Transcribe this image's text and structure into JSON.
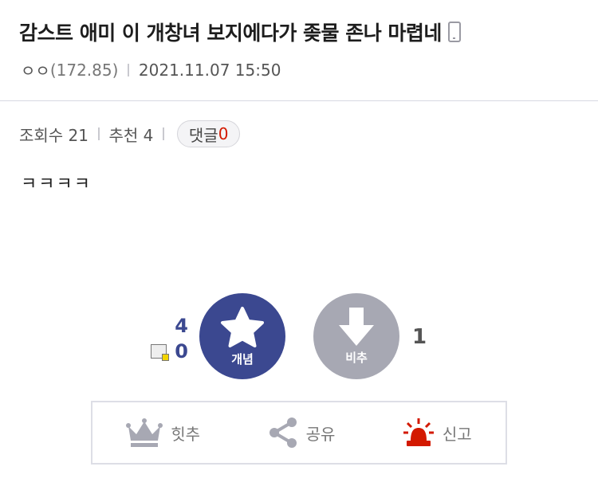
{
  "post": {
    "title": "감스트 애미 이 개창녀 보지에다가 좆물 존나 마렵네",
    "author": "ㅇㅇ",
    "author_ip": "(172.85)",
    "datetime": "2021.11.07 15:50"
  },
  "stats": {
    "views_label": "조회수 21",
    "recommend_label": "추천 4",
    "comment_label": "댓글",
    "comment_count": "0"
  },
  "content": {
    "body": "ㅋㅋㅋㅋ"
  },
  "vote": {
    "up_count": "4",
    "fixed_up_count": "0",
    "up_label": "개념",
    "down_label": "비추",
    "down_count": "1"
  },
  "actions": {
    "best_label": "힛추",
    "share_label": "공유",
    "report_label": "신고"
  },
  "colors": {
    "accent": "#3b4890",
    "down_gray": "#a7a8b3",
    "report_red": "#d31900"
  },
  "icons": [
    "mobile-icon",
    "fixed-recommend-icon",
    "star-icon",
    "down-arrow-icon",
    "crown-icon",
    "share-icon",
    "siren-icon"
  ]
}
